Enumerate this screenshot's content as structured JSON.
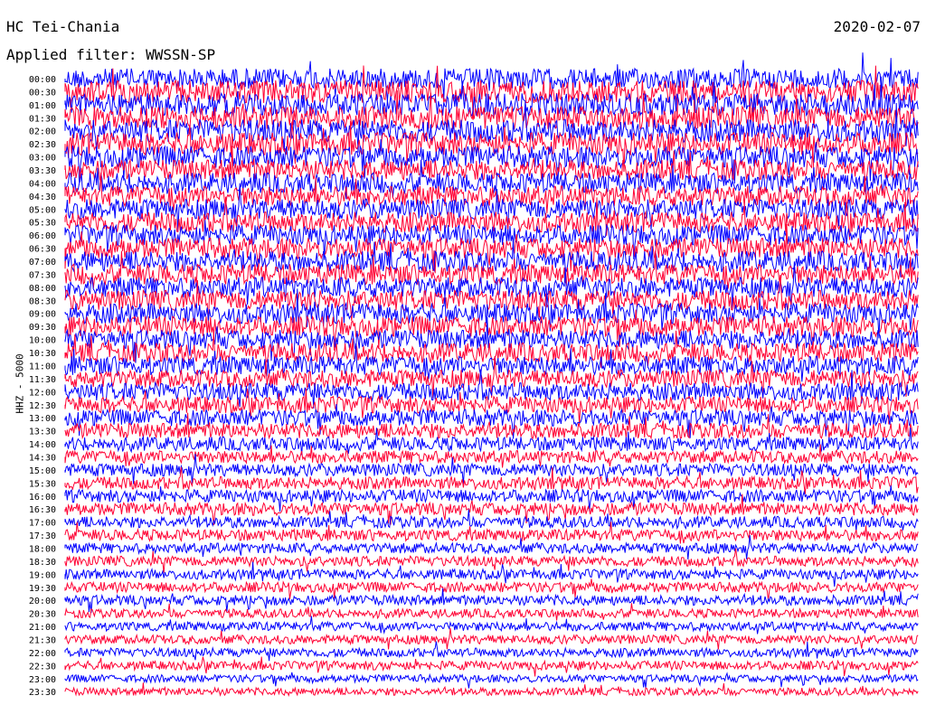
{
  "header": {
    "station": "HC Tei-Chania",
    "date": "2020-02-07",
    "filter": "Applied filter: WWSSN-SP"
  },
  "channel_label": "HHZ - 5000",
  "colors": {
    "even_trace": "#0000ff",
    "odd_trace": "#ff0033"
  },
  "chart_data": {
    "type": "line",
    "title": "HC Tei-Chania",
    "date": "2020-02-07",
    "subtitle": "Applied filter: WWSSN-SP",
    "ylabel": "HHZ - 5000",
    "row_labels": [
      "00:00",
      "00:30",
      "01:00",
      "01:30",
      "02:00",
      "02:30",
      "03:00",
      "03:30",
      "04:00",
      "04:30",
      "05:00",
      "05:30",
      "06:00",
      "06:30",
      "07:00",
      "07:30",
      "08:00",
      "08:30",
      "09:00",
      "09:30",
      "10:00",
      "10:30",
      "11:00",
      "11:30",
      "12:00",
      "12:30",
      "13:00",
      "13:30",
      "14:00",
      "14:30",
      "15:00",
      "15:30",
      "16:00",
      "16:30",
      "17:00",
      "17:30",
      "18:00",
      "18:30",
      "19:00",
      "19:30",
      "20:00",
      "20:30",
      "21:00",
      "21:30",
      "22:00",
      "22:30",
      "23:00",
      "23:30"
    ],
    "row_minutes": 30,
    "series_colors_alternating": [
      "#0000ff",
      "#ff0033"
    ],
    "row_amplitude": [
      1.6,
      1.8,
      1.8,
      1.8,
      1.8,
      1.8,
      1.7,
      1.6,
      1.6,
      1.6,
      1.6,
      1.6,
      1.6,
      1.6,
      1.6,
      1.6,
      1.6,
      1.6,
      1.6,
      1.6,
      1.5,
      1.5,
      1.5,
      1.4,
      1.4,
      1.3,
      1.3,
      1.2,
      1.1,
      1.0,
      1.0,
      1.0,
      1.0,
      1.0,
      0.9,
      0.9,
      0.8,
      0.8,
      0.8,
      0.8,
      0.8,
      0.7,
      0.7,
      0.7,
      0.7,
      0.7,
      0.6,
      0.6
    ],
    "grid": false
  }
}
